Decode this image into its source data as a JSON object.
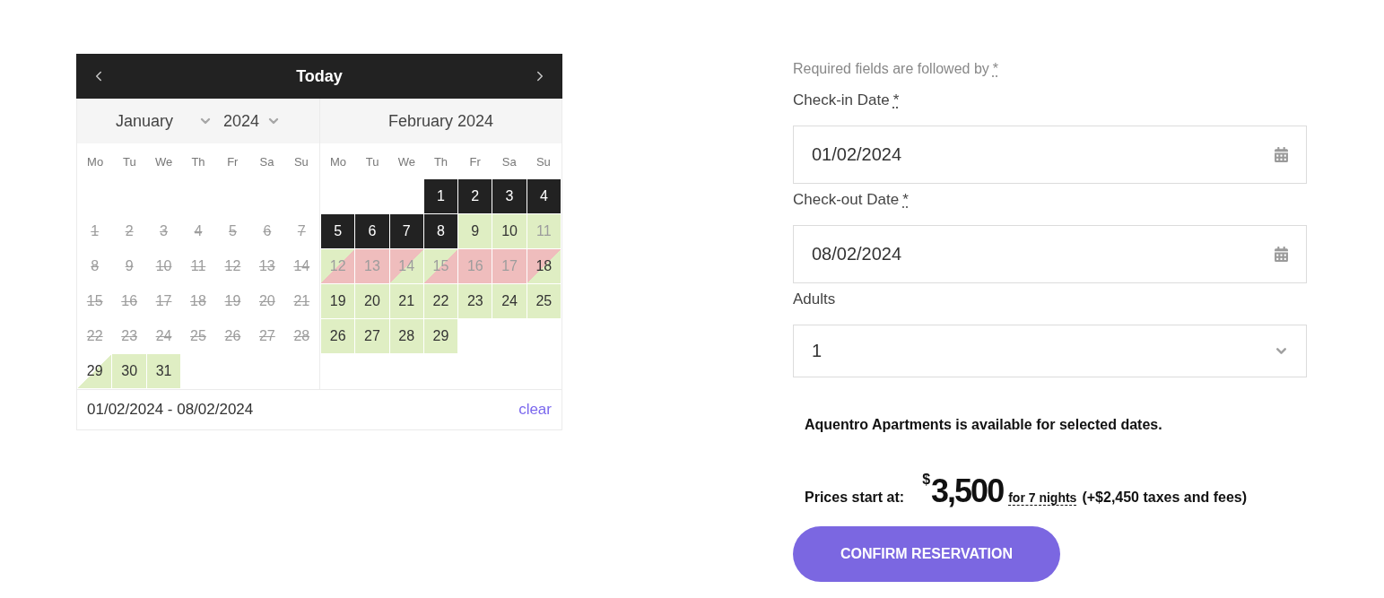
{
  "calendar": {
    "today_label": "Today",
    "months": [
      {
        "kind": "selects",
        "month": "January",
        "year": "2024",
        "weekdays": [
          "Mo",
          "Tu",
          "We",
          "Th",
          "Fr",
          "Sa",
          "Su"
        ],
        "weeks": [
          [
            {
              "kind": "blank"
            },
            {
              "kind": "blank"
            },
            {
              "kind": "blank"
            },
            {
              "kind": "blank"
            },
            {
              "kind": "blank"
            },
            {
              "kind": "blank"
            },
            {
              "kind": "blank"
            }
          ],
          [
            {
              "label": "1",
              "kind": "past",
              "selected": false,
              "disabled": true
            },
            {
              "label": "2",
              "kind": "past",
              "selected": false,
              "disabled": true
            },
            {
              "label": "3",
              "kind": "past",
              "selected": false,
              "disabled": true
            },
            {
              "label": "4",
              "kind": "past",
              "selected": false,
              "disabled": true
            },
            {
              "label": "5",
              "kind": "past",
              "selected": false,
              "disabled": true
            },
            {
              "label": "6",
              "kind": "past",
              "selected": false,
              "disabled": true
            },
            {
              "label": "7",
              "kind": "past",
              "selected": false,
              "disabled": true
            }
          ],
          [
            {
              "label": "8",
              "kind": "past",
              "selected": false,
              "disabled": true
            },
            {
              "label": "9",
              "kind": "past",
              "selected": false,
              "disabled": true
            },
            {
              "label": "10",
              "kind": "past",
              "selected": false,
              "disabled": true
            },
            {
              "label": "11",
              "kind": "past",
              "selected": false,
              "disabled": true
            },
            {
              "label": "12",
              "kind": "past",
              "selected": false,
              "disabled": true
            },
            {
              "label": "13",
              "kind": "past",
              "selected": false,
              "disabled": true
            },
            {
              "label": "14",
              "kind": "past",
              "selected": false,
              "disabled": true
            }
          ],
          [
            {
              "label": "15",
              "kind": "past",
              "selected": false,
              "disabled": true
            },
            {
              "label": "16",
              "kind": "past",
              "selected": false,
              "disabled": true
            },
            {
              "label": "17",
              "kind": "past",
              "selected": false,
              "disabled": true
            },
            {
              "label": "18",
              "kind": "past",
              "selected": false,
              "disabled": true
            },
            {
              "label": "19",
              "kind": "past",
              "selected": false,
              "disabled": true
            },
            {
              "label": "20",
              "kind": "past",
              "selected": false,
              "disabled": true
            },
            {
              "label": "21",
              "kind": "past",
              "selected": false,
              "disabled": true
            }
          ],
          [
            {
              "label": "22",
              "kind": "past",
              "selected": false,
              "disabled": true
            },
            {
              "label": "23",
              "kind": "past",
              "selected": false,
              "disabled": true
            },
            {
              "label": "24",
              "kind": "past",
              "selected": false,
              "disabled": true
            },
            {
              "label": "25",
              "kind": "past",
              "selected": false,
              "disabled": true
            },
            {
              "label": "26",
              "kind": "past",
              "selected": false,
              "disabled": true
            },
            {
              "label": "27",
              "kind": "past",
              "selected": false,
              "disabled": true
            },
            {
              "label": "28",
              "kind": "past",
              "selected": false,
              "disabled": true
            }
          ],
          [
            {
              "label": "29",
              "kind": "past-free",
              "selected": false,
              "disabled": false
            },
            {
              "label": "30",
              "kind": "free",
              "selected": false,
              "disabled": false
            },
            {
              "label": "31",
              "kind": "free",
              "selected": false,
              "disabled": false
            }
          ]
        ]
      },
      {
        "kind": "title",
        "title": "February 2024",
        "weekdays": [
          "Mo",
          "Tu",
          "We",
          "Th",
          "Fr",
          "Sa",
          "Su"
        ],
        "weeks": [
          [
            {
              "kind": "blank"
            },
            {
              "kind": "blank"
            },
            {
              "kind": "blank"
            },
            {
              "label": "1",
              "kind": "free",
              "selected": true,
              "disabled": false
            },
            {
              "label": "2",
              "kind": "free",
              "selected": true,
              "disabled": false
            },
            {
              "label": "3",
              "kind": "free",
              "selected": true,
              "disabled": false
            },
            {
              "label": "4",
              "kind": "free",
              "selected": true,
              "disabled": false
            }
          ],
          [
            {
              "label": "5",
              "kind": "free",
              "selected": true,
              "disabled": false
            },
            {
              "label": "6",
              "kind": "free",
              "selected": true,
              "disabled": false
            },
            {
              "label": "7",
              "kind": "free",
              "selected": true,
              "disabled": false
            },
            {
              "label": "8",
              "kind": "free",
              "selected": true,
              "disabled": false
            },
            {
              "label": "9",
              "kind": "free",
              "selected": false,
              "disabled": false
            },
            {
              "label": "10",
              "kind": "free",
              "selected": false,
              "disabled": false
            },
            {
              "label": "11",
              "kind": "free",
              "selected": false,
              "disabled": true
            }
          ],
          [
            {
              "label": "12",
              "kind": "free-booked",
              "selected": false,
              "disabled": true
            },
            {
              "label": "13",
              "kind": "booked",
              "selected": false,
              "disabled": true
            },
            {
              "label": "14",
              "kind": "booked-free",
              "selected": false,
              "disabled": true
            },
            {
              "label": "15",
              "kind": "free-booked",
              "selected": false,
              "disabled": true
            },
            {
              "label": "16",
              "kind": "booked",
              "selected": false,
              "disabled": true
            },
            {
              "label": "17",
              "kind": "booked",
              "selected": false,
              "disabled": true
            },
            {
              "label": "18",
              "kind": "booked-free",
              "selected": false,
              "disabled": false
            }
          ],
          [
            {
              "label": "19",
              "kind": "free",
              "selected": false,
              "disabled": false
            },
            {
              "label": "20",
              "kind": "free",
              "selected": false,
              "disabled": false
            },
            {
              "label": "21",
              "kind": "free",
              "selected": false,
              "disabled": false
            },
            {
              "label": "22",
              "kind": "free",
              "selected": false,
              "disabled": false
            },
            {
              "label": "23",
              "kind": "free",
              "selected": false,
              "disabled": false
            },
            {
              "label": "24",
              "kind": "free",
              "selected": false,
              "disabled": false
            },
            {
              "label": "25",
              "kind": "free",
              "selected": false,
              "disabled": false
            }
          ],
          [
            {
              "label": "26",
              "kind": "free",
              "selected": false,
              "disabled": false
            },
            {
              "label": "27",
              "kind": "free",
              "selected": false,
              "disabled": false
            },
            {
              "label": "28",
              "kind": "free",
              "selected": false,
              "disabled": false
            },
            {
              "label": "29",
              "kind": "free",
              "selected": false,
              "disabled": false
            }
          ]
        ]
      }
    ],
    "range": "01/02/2024 - 08/02/2024",
    "clear_label": "clear"
  },
  "form": {
    "required_note": {
      "text": "Required fields are followed by",
      "mark": "*"
    },
    "fields": [
      {
        "kind": "date",
        "label": "Check-in Date",
        "required_mark": "*",
        "value": "01/02/2024"
      },
      {
        "kind": "date",
        "label": "Check-out Date",
        "required_mark": "*",
        "value": "08/02/2024"
      },
      {
        "kind": "select",
        "label": "Adults",
        "value": "1"
      }
    ],
    "availability": "Aquentro Apartments is available for selected dates.",
    "price": {
      "label": "Prices start at:",
      "currency": "$",
      "amount": "3,500",
      "nights": "for 7 nights",
      "taxes": "(+$2,450 taxes and fees)"
    },
    "confirm_button": "CONFIRM RESERVATION"
  }
}
